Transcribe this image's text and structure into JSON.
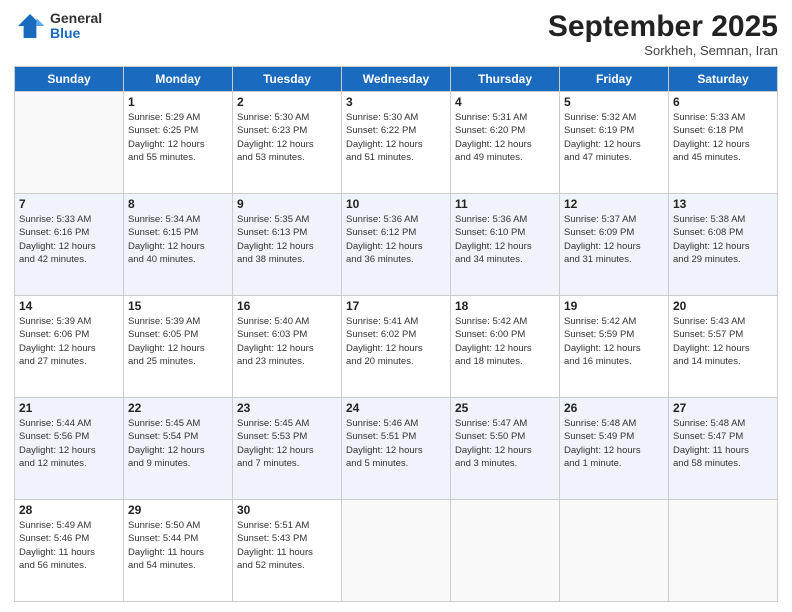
{
  "logo": {
    "general": "General",
    "blue": "Blue"
  },
  "header": {
    "month": "September 2025",
    "location": "Sorkheh, Semnan, Iran"
  },
  "days_of_week": [
    "Sunday",
    "Monday",
    "Tuesday",
    "Wednesday",
    "Thursday",
    "Friday",
    "Saturday"
  ],
  "weeks": [
    [
      {
        "day": "",
        "info": ""
      },
      {
        "day": "1",
        "info": "Sunrise: 5:29 AM\nSunset: 6:25 PM\nDaylight: 12 hours\nand 55 minutes."
      },
      {
        "day": "2",
        "info": "Sunrise: 5:30 AM\nSunset: 6:23 PM\nDaylight: 12 hours\nand 53 minutes."
      },
      {
        "day": "3",
        "info": "Sunrise: 5:30 AM\nSunset: 6:22 PM\nDaylight: 12 hours\nand 51 minutes."
      },
      {
        "day": "4",
        "info": "Sunrise: 5:31 AM\nSunset: 6:20 PM\nDaylight: 12 hours\nand 49 minutes."
      },
      {
        "day": "5",
        "info": "Sunrise: 5:32 AM\nSunset: 6:19 PM\nDaylight: 12 hours\nand 47 minutes."
      },
      {
        "day": "6",
        "info": "Sunrise: 5:33 AM\nSunset: 6:18 PM\nDaylight: 12 hours\nand 45 minutes."
      }
    ],
    [
      {
        "day": "7",
        "info": "Sunrise: 5:33 AM\nSunset: 6:16 PM\nDaylight: 12 hours\nand 42 minutes."
      },
      {
        "day": "8",
        "info": "Sunrise: 5:34 AM\nSunset: 6:15 PM\nDaylight: 12 hours\nand 40 minutes."
      },
      {
        "day": "9",
        "info": "Sunrise: 5:35 AM\nSunset: 6:13 PM\nDaylight: 12 hours\nand 38 minutes."
      },
      {
        "day": "10",
        "info": "Sunrise: 5:36 AM\nSunset: 6:12 PM\nDaylight: 12 hours\nand 36 minutes."
      },
      {
        "day": "11",
        "info": "Sunrise: 5:36 AM\nSunset: 6:10 PM\nDaylight: 12 hours\nand 34 minutes."
      },
      {
        "day": "12",
        "info": "Sunrise: 5:37 AM\nSunset: 6:09 PM\nDaylight: 12 hours\nand 31 minutes."
      },
      {
        "day": "13",
        "info": "Sunrise: 5:38 AM\nSunset: 6:08 PM\nDaylight: 12 hours\nand 29 minutes."
      }
    ],
    [
      {
        "day": "14",
        "info": "Sunrise: 5:39 AM\nSunset: 6:06 PM\nDaylight: 12 hours\nand 27 minutes."
      },
      {
        "day": "15",
        "info": "Sunrise: 5:39 AM\nSunset: 6:05 PM\nDaylight: 12 hours\nand 25 minutes."
      },
      {
        "day": "16",
        "info": "Sunrise: 5:40 AM\nSunset: 6:03 PM\nDaylight: 12 hours\nand 23 minutes."
      },
      {
        "day": "17",
        "info": "Sunrise: 5:41 AM\nSunset: 6:02 PM\nDaylight: 12 hours\nand 20 minutes."
      },
      {
        "day": "18",
        "info": "Sunrise: 5:42 AM\nSunset: 6:00 PM\nDaylight: 12 hours\nand 18 minutes."
      },
      {
        "day": "19",
        "info": "Sunrise: 5:42 AM\nSunset: 5:59 PM\nDaylight: 12 hours\nand 16 minutes."
      },
      {
        "day": "20",
        "info": "Sunrise: 5:43 AM\nSunset: 5:57 PM\nDaylight: 12 hours\nand 14 minutes."
      }
    ],
    [
      {
        "day": "21",
        "info": "Sunrise: 5:44 AM\nSunset: 5:56 PM\nDaylight: 12 hours\nand 12 minutes."
      },
      {
        "day": "22",
        "info": "Sunrise: 5:45 AM\nSunset: 5:54 PM\nDaylight: 12 hours\nand 9 minutes."
      },
      {
        "day": "23",
        "info": "Sunrise: 5:45 AM\nSunset: 5:53 PM\nDaylight: 12 hours\nand 7 minutes."
      },
      {
        "day": "24",
        "info": "Sunrise: 5:46 AM\nSunset: 5:51 PM\nDaylight: 12 hours\nand 5 minutes."
      },
      {
        "day": "25",
        "info": "Sunrise: 5:47 AM\nSunset: 5:50 PM\nDaylight: 12 hours\nand 3 minutes."
      },
      {
        "day": "26",
        "info": "Sunrise: 5:48 AM\nSunset: 5:49 PM\nDaylight: 12 hours\nand 1 minute."
      },
      {
        "day": "27",
        "info": "Sunrise: 5:48 AM\nSunset: 5:47 PM\nDaylight: 11 hours\nand 58 minutes."
      }
    ],
    [
      {
        "day": "28",
        "info": "Sunrise: 5:49 AM\nSunset: 5:46 PM\nDaylight: 11 hours\nand 56 minutes."
      },
      {
        "day": "29",
        "info": "Sunrise: 5:50 AM\nSunset: 5:44 PM\nDaylight: 11 hours\nand 54 minutes."
      },
      {
        "day": "30",
        "info": "Sunrise: 5:51 AM\nSunset: 5:43 PM\nDaylight: 11 hours\nand 52 minutes."
      },
      {
        "day": "",
        "info": ""
      },
      {
        "day": "",
        "info": ""
      },
      {
        "day": "",
        "info": ""
      },
      {
        "day": "",
        "info": ""
      }
    ]
  ]
}
